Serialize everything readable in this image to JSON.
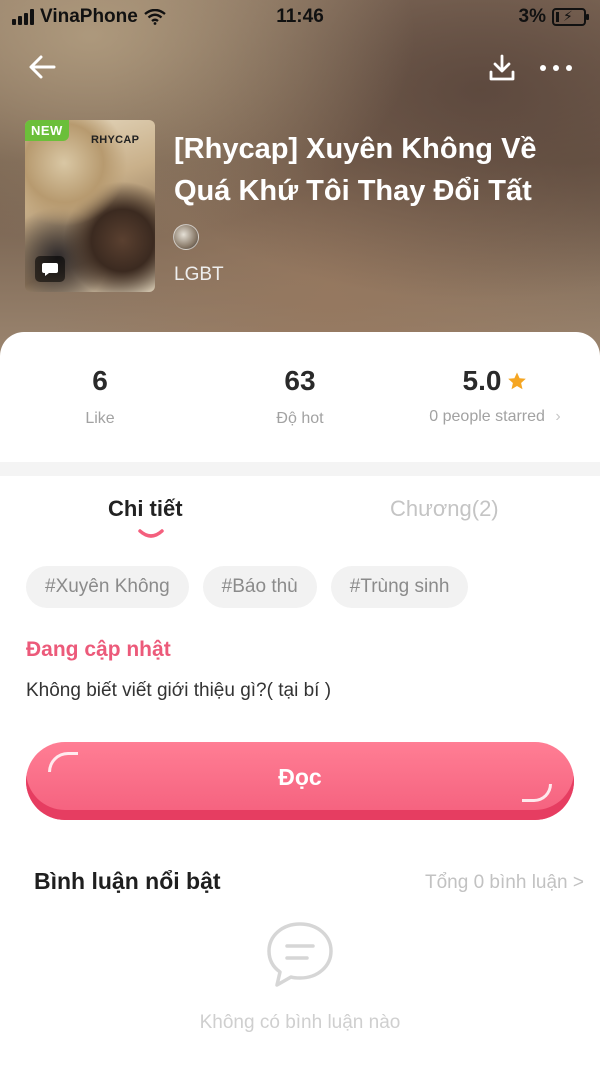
{
  "status_bar": {
    "carrier": "VinaPhone",
    "time": "11:46",
    "battery_percent": "3%"
  },
  "nav": {
    "back_icon": "arrow-left-icon",
    "download_icon": "download-icon",
    "more_icon": "more-dots-icon"
  },
  "book": {
    "cover_badge": "NEW",
    "cover_brand": "RHYCAP",
    "title": "[Rhycap] Xuyên Không Về Quá Khứ Tôi Thay Đổi Tất",
    "genre": "LGBT"
  },
  "stats": {
    "likes_value": "6",
    "likes_label": "Like",
    "hot_value": "63",
    "hot_label": "Độ hot",
    "rating_value": "5.0",
    "rating_label": "0 people starred",
    "star_color": "#f5a623"
  },
  "tabs": {
    "detail": "Chi tiết",
    "chapters": "Chương(2)"
  },
  "tags": [
    "#Xuyên Không",
    "#Báo thù",
    "#Trùng sinh"
  ],
  "update_status": "Đang cập nhật",
  "description": "Không biết viết giới thiệu gì?( tại bí )",
  "read_button": "Đọc",
  "comments": {
    "title": "Bình luận nổi bật",
    "total": "Tổng 0 bình luận >",
    "empty_text": "Không có bình luận nào"
  },
  "colors": {
    "accent": "#f45f7d",
    "update_text": "#ec5a7a"
  }
}
